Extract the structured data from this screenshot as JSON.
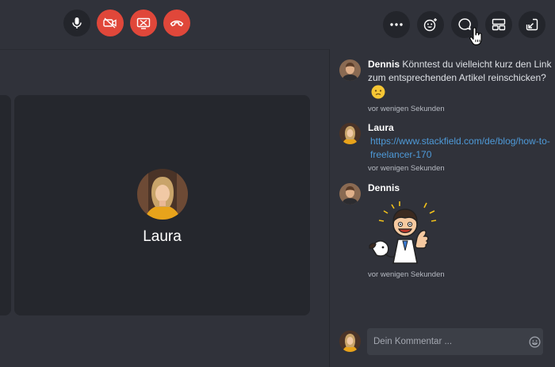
{
  "call_controls": {
    "mic_icon": "microphone-icon",
    "camera_off_icon": "camera-off-icon",
    "screenshare_off_icon": "screenshare-off-icon",
    "hangup_icon": "hangup-icon"
  },
  "toolbar": {
    "more_icon": "more-icon",
    "emoji_icon": "emoji-add-icon",
    "chat_icon": "chat-bubble-icon",
    "layout_icon": "layout-icon",
    "minimize_icon": "minimize-icon"
  },
  "participant": {
    "name": "Laura"
  },
  "chat": {
    "messages": [
      {
        "author": "Dennis",
        "text": "Könntest du vielleicht kurz den Link zum entsprechenden Artikel reinschicken?",
        "time": "vor wenigen Sekunden"
      },
      {
        "author": "Laura",
        "link": "https://www.stackfield.com/de/blog/how-to-freelancer-170",
        "time": "vor wenigen Sekunden"
      },
      {
        "author": "Dennis",
        "time": "vor wenigen Sekunden"
      }
    ],
    "composer": {
      "placeholder": "Dein Kommentar ..."
    }
  },
  "colors": {
    "background": "#30323a",
    "tile": "#25272d",
    "danger": "#e0473a",
    "link": "#4e9ad8"
  }
}
